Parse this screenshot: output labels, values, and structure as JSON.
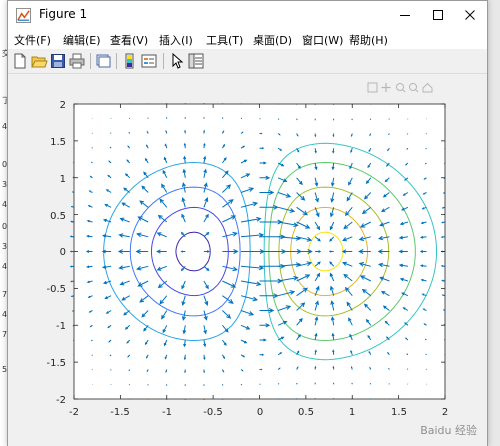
{
  "window": {
    "title": "Figure 1"
  },
  "menu": [
    "文件(F)",
    "编辑(E)",
    "查看(V)",
    "插入(I)",
    "工具(T)",
    "桌面(D)",
    "窗口(W)",
    "帮助(H)"
  ],
  "toolbar_icons": [
    "new-figure-icon",
    "open-file-icon",
    "save-icon",
    "print-icon",
    "link-plot-icon",
    "insert-colorbar-icon",
    "insert-legend-icon",
    "edit-plot-icon",
    "property-inspector-icon"
  ],
  "axes": {
    "x_ticks": [
      "-2",
      "-1.5",
      "-1",
      "-0.5",
      "0",
      "0.5",
      "1",
      "1.5",
      "2"
    ],
    "y_ticks": [
      "2",
      "1.5",
      "1",
      "0.5",
      "0",
      "-0.5",
      "-1",
      "-1.5",
      "-2"
    ]
  },
  "background_app_fragments": [
    "交",
    "了",
    "4",
    "0",
    "3",
    "4",
    "0",
    "3",
    "4",
    "7",
    "4",
    "7",
    "5"
  ],
  "watermark": "Baidu 经验",
  "chart_data": {
    "type": "contour+quiver",
    "xlim": [
      -2,
      2
    ],
    "ylim": [
      -2,
      2
    ],
    "x_ticks": [
      -2,
      -1.5,
      -1,
      -0.5,
      0,
      0.5,
      1,
      1.5,
      2
    ],
    "y_ticks": [
      -2,
      -1.5,
      -1,
      -0.5,
      0,
      0.5,
      1,
      1.5,
      2
    ],
    "grid": false,
    "field": "z = x * exp(-x^2 - y^2)",
    "contour_levels": [
      -0.4,
      -0.3,
      -0.2,
      -0.1,
      0.05,
      0.1,
      0.2,
      0.3,
      0.4
    ],
    "contour_colors": [
      "#3e26a8",
      "#4746eb",
      "#3f78fc",
      "#2aa6e6",
      "#35c5c2",
      "#5cc86b",
      "#a5be2a",
      "#e0b52f",
      "#f9e215"
    ],
    "quiver_color": "#0072bd"
  }
}
